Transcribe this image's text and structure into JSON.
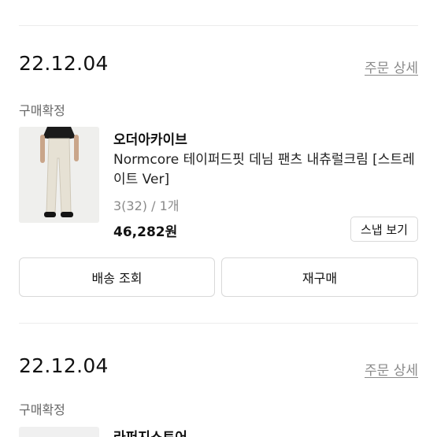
{
  "orders": [
    {
      "date": "22.12.04",
      "detail_link": "주문 상세",
      "status": "구매확정",
      "brand": "오더아카이브",
      "product_name": "Normcore 테이퍼드핏 데님 팬츠 내츄럴크림 [스트레이트 Ver]",
      "option": "3(32) / 1개",
      "price": "46,282원",
      "snap_button": "스냅 보기",
      "track_button": "배송 조회",
      "rebuy_button": "재구매"
    },
    {
      "date": "22.12.04",
      "detail_link": "주문 상세",
      "status": "구매확정",
      "brand": "라퍼지스토어"
    }
  ]
}
